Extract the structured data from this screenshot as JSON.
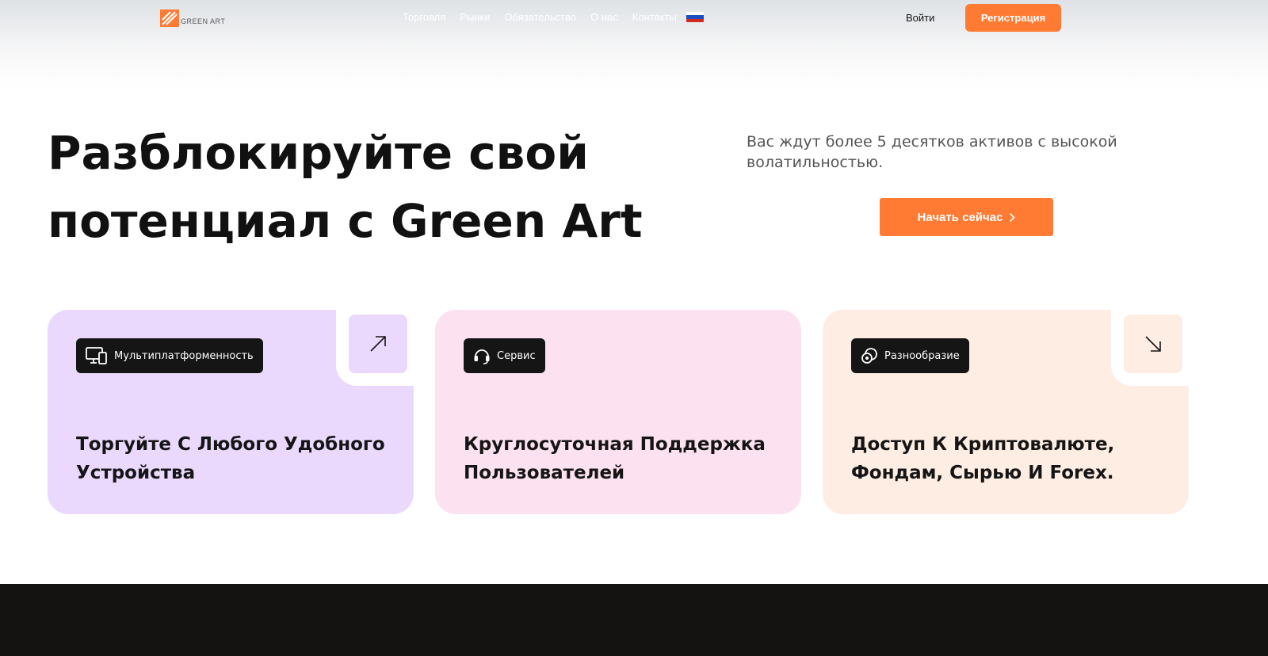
{
  "colors": {
    "accent": "#ff7a33",
    "card_purple": "#ead9fd",
    "card_pink": "#fce2f0",
    "card_peach": "#fdede2",
    "dark": "#151311"
  },
  "header": {
    "logo_text": "GREEN ART",
    "nav": [
      "Торговля",
      "Рынки",
      "Обязательство",
      "О нас",
      "Контакты"
    ],
    "language_icon": "russian-flag-icon",
    "login_label": "Войти",
    "register_label": "Регистрация"
  },
  "hero": {
    "title_line1": "Разблокируйте свой",
    "title_line2": "потенциал с Green Art",
    "subtitle": "Вас ждут более 5 десятков активов с высокой волатильностью.",
    "cta_label": "Начать сейчас"
  },
  "cards": [
    {
      "tag": "Мультиплатформенность",
      "tag_icon": "devices-icon",
      "title": "Торгуйте С Любого Удобного Устройства",
      "arrow_icon": "arrow-up-right-icon"
    },
    {
      "tag": "Сервис",
      "tag_icon": "headset-icon",
      "title": "Круглосуточная Поддержка Пользователей"
    },
    {
      "tag": "Разнообразие",
      "tag_icon": "coins-icon",
      "title": "Доступ К Криптовалюте, Фондам, Сырью И Forex.",
      "arrow_icon": "arrow-down-right-icon"
    }
  ]
}
